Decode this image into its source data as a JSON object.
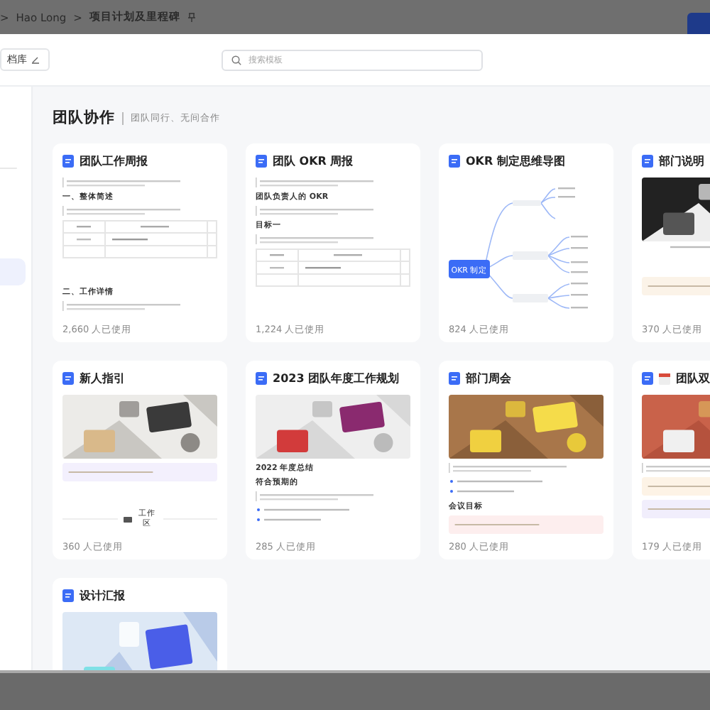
{
  "backdrop": {
    "breadcrumb": [
      {
        "text": ">"
      },
      {
        "text": "Hao Long"
      },
      {
        "text": ">"
      },
      {
        "text": "项目计划及里程碑"
      }
    ]
  },
  "modal": {
    "library_button": "档库",
    "search": {
      "placeholder": "搜索模板"
    },
    "sidebar": {
      "items": [
        {
          "selected": false
        },
        {
          "selected": true
        }
      ]
    },
    "section": {
      "title": "团队协作",
      "subtitle": "团队同行、无间合作"
    },
    "cards": [
      {
        "title": "团队工作周报",
        "uses": "2,660 人已使用",
        "blocks": [
          {
            "kind": "quote"
          },
          {
            "kind": "heading",
            "text": "一、整体简述"
          },
          {
            "kind": "quote"
          },
          {
            "kind": "table"
          },
          {
            "kind": "space"
          },
          {
            "kind": "heading",
            "text": "二、工作详情"
          },
          {
            "kind": "quote"
          }
        ]
      },
      {
        "title": "团队 OKR 周报",
        "uses": "1,224 人已使用",
        "blocks": [
          {
            "kind": "quote"
          },
          {
            "kind": "heading",
            "text": "团队负责人的 OKR"
          },
          {
            "kind": "quote"
          },
          {
            "kind": "heading",
            "text": "目标一"
          },
          {
            "kind": "quote"
          },
          {
            "kind": "table"
          }
        ]
      },
      {
        "title": "OKR 制定思维导图",
        "uses": "824 人已使用",
        "blocks": [
          {
            "kind": "mindmap",
            "text": "OKR 制定"
          }
        ]
      },
      {
        "title": "部门说明",
        "uses": "370 人已使用",
        "blocks": [
          {
            "kind": "picture"
          },
          {
            "kind": "caption"
          },
          {
            "kind": "space"
          },
          {
            "kind": "note",
            "color": "#fbf3e8"
          }
        ]
      },
      {
        "title": "新人指引",
        "uses": "360 人已使用",
        "blocks": [
          {
            "kind": "picture"
          },
          {
            "kind": "note",
            "color": "#f3f0fd"
          },
          {
            "kind": "space"
          },
          {
            "kind": "divider",
            "text": "工作区"
          }
        ]
      },
      {
        "title": "2023 团队年度工作规划",
        "uses": "285 人已使用",
        "blocks": [
          {
            "kind": "picture"
          },
          {
            "kind": "heading",
            "text": "2022 年度总结"
          },
          {
            "kind": "heading",
            "text": "符合预期的"
          },
          {
            "kind": "quote"
          },
          {
            "kind": "bullets"
          }
        ]
      },
      {
        "title": "部门周会",
        "uses": "280 人已使用",
        "blocks": [
          {
            "kind": "picture"
          },
          {
            "kind": "quote"
          },
          {
            "kind": "bullets"
          },
          {
            "kind": "heading",
            "text": "会议目标"
          },
          {
            "kind": "note",
            "color": "#fdeeee"
          }
        ]
      },
      {
        "title": "团队双",
        "uses": "179 人已使用",
        "calendar": true,
        "blocks": [
          {
            "kind": "picture"
          },
          {
            "kind": "quote"
          },
          {
            "kind": "note",
            "color": "#fdf3e6"
          },
          {
            "kind": "note",
            "color": "#f1eefc"
          }
        ]
      },
      {
        "title": "设计汇报",
        "blocks": [
          {
            "kind": "picture"
          }
        ]
      }
    ]
  }
}
